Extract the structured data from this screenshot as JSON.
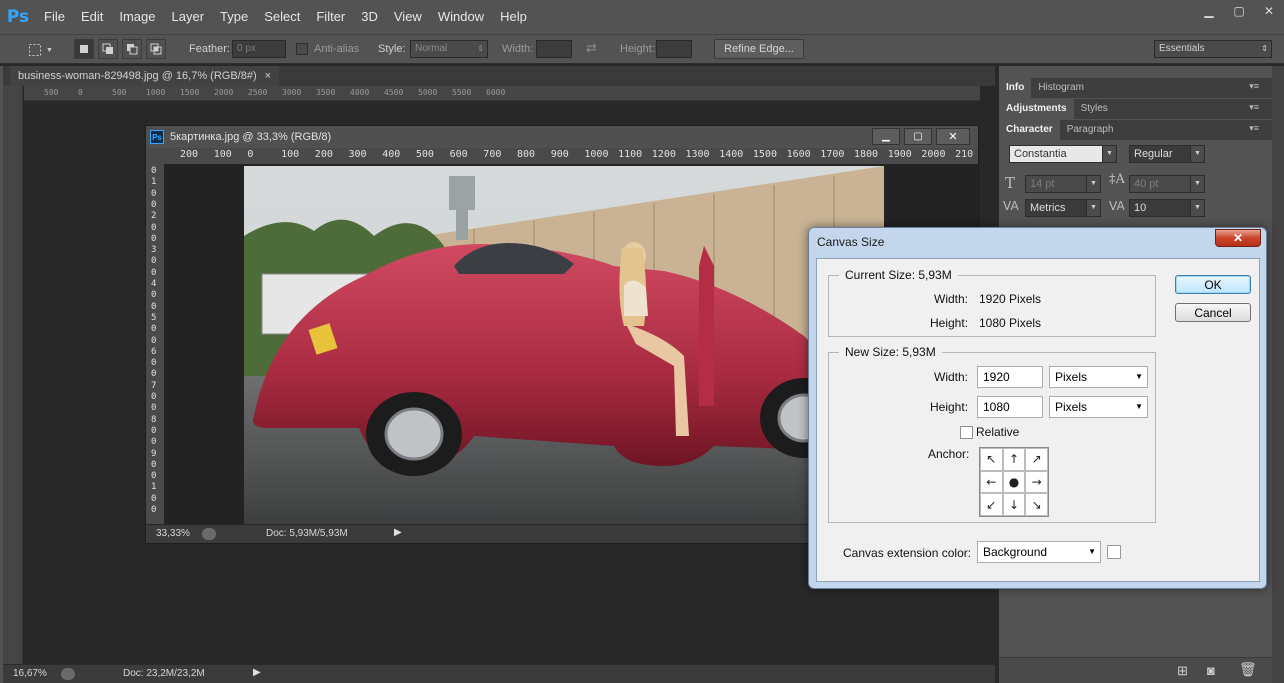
{
  "app": {
    "logo": "Ps",
    "menu": [
      "File",
      "Edit",
      "Image",
      "Layer",
      "Type",
      "Select",
      "Filter",
      "3D",
      "View",
      "Window",
      "Help"
    ]
  },
  "options_bar": {
    "feather_label": "Feather:",
    "feather_value": "0 px",
    "antialias_label": "Anti-alias",
    "style_label": "Style:",
    "style_value": "Normal",
    "width_label": "Width:",
    "height_label": "Height:",
    "refine_edge_label": "Refine Edge...",
    "workspace_value": "Essentials"
  },
  "main_document": {
    "tab_title": "business-woman-829498.jpg @ 16,7% (RGB/8#)",
    "tab_close": "×",
    "zoom": "16,67%",
    "doc_info": "Doc: 23,2M/23,2M",
    "ruler_ticks": [
      "500",
      "0",
      "500",
      "1000",
      "1500",
      "2000",
      "2500",
      "3000",
      "3500",
      "4000",
      "4500",
      "5000",
      "5500",
      "6000"
    ]
  },
  "float_document": {
    "title": "5картинка.jpg @ 33,3% (RGB/8)",
    "zoom": "33,33%",
    "doc_info": "Doc: 5,93M/5,93M",
    "ruler_ticks_h": [
      "200",
      "100",
      "0",
      "100",
      "200",
      "300",
      "400",
      "500",
      "600",
      "700",
      "800",
      "900",
      "1000",
      "1100",
      "1200",
      "1300",
      "1400",
      "1500",
      "1600",
      "1700",
      "1800",
      "1900",
      "2000",
      "210"
    ],
    "ruler_ticks_v": [
      "0",
      "1",
      "0",
      "0",
      "2",
      "0",
      "0",
      "3",
      "0",
      "0",
      "4",
      "0",
      "0",
      "5",
      "0",
      "0",
      "6",
      "0",
      "0",
      "7",
      "0",
      "0",
      "8",
      "0",
      "0",
      "9",
      "0",
      "0",
      "1",
      "0",
      "0"
    ]
  },
  "right_panel": {
    "tabs_row1": [
      "Info",
      "Histogram"
    ],
    "tabs_row2": [
      "Adjustments",
      "Styles"
    ],
    "tabs_row3": [
      "Character",
      "Paragraph"
    ],
    "font_family": "Constantia",
    "font_style": "Regular",
    "font_size": "14 pt",
    "leading": "40 pt",
    "kerning": "Metrics",
    "tracking": "10"
  },
  "dialog": {
    "title": "Canvas Size",
    "close": "✕",
    "current_size_legend": "Current Size: 5,93M",
    "current_width_label": "Width:",
    "current_width_value": "1920 Pixels",
    "current_height_label": "Height:",
    "current_height_value": "1080 Pixels",
    "new_size_legend": "New Size: 5,93M",
    "width_label": "Width:",
    "width_value": "1920",
    "width_unit": "Pixels",
    "height_label": "Height:",
    "height_value": "1080",
    "height_unit": "Pixels",
    "relative_label": "Relative",
    "relative_checked": false,
    "anchor_label": "Anchor:",
    "anchor_arrows": [
      "↖",
      "↑",
      "↗",
      "←",
      "●",
      "→",
      "↙",
      "↓",
      "↘"
    ],
    "extension_label": "Canvas extension color:",
    "extension_value": "Background",
    "ok_label": "OK",
    "cancel_label": "Cancel"
  }
}
